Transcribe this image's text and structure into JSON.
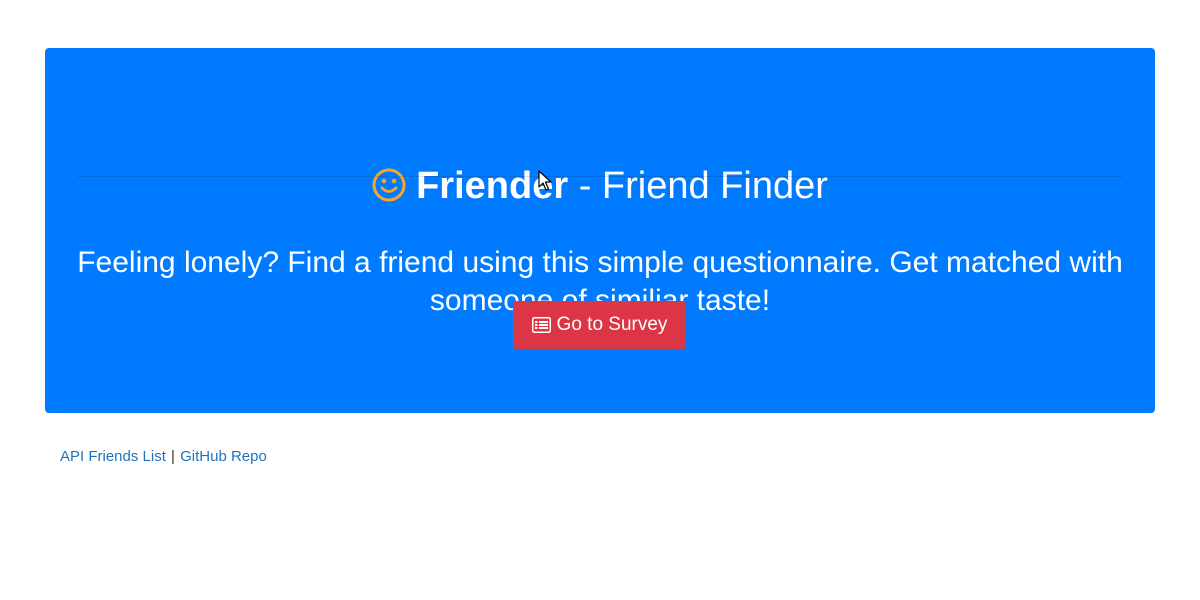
{
  "header": {
    "brand": "Friender",
    "title_rest": " - Friend Finder",
    "icon": "smile-icon",
    "icon_color": "#f5a623"
  },
  "lead": "Feeling lonely? Find a friend using this simple questionnaire. Get matched with someone of similiar taste!",
  "survey_button": {
    "label": "Go to Survey",
    "icon": "list-alt-icon",
    "color": "#dc3545"
  },
  "footer": {
    "api_link": "API Friends List",
    "separator": "|",
    "github_link": "GitHub Repo"
  },
  "colors": {
    "jumbotron": "#007bff",
    "link": "#1e73be"
  }
}
